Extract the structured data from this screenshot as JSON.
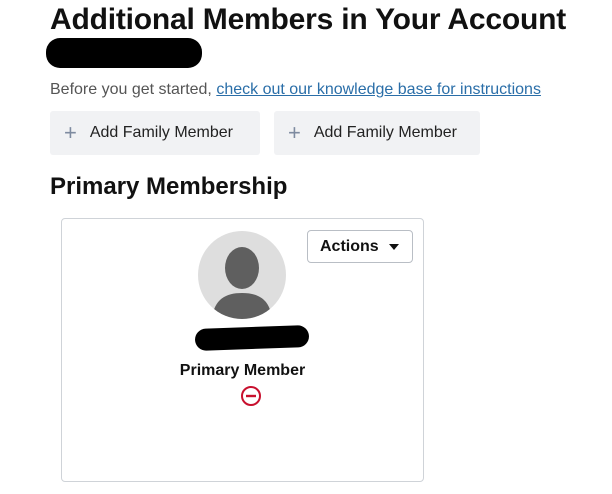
{
  "header": {
    "title": "Additional Members in Your Account"
  },
  "intro": {
    "text": "Before you get started, ",
    "link_text": "check out our knowledge base for instructions"
  },
  "add_buttons": [
    {
      "icon": "plus-icon",
      "label": "Add Family Member"
    },
    {
      "icon": "plus-icon",
      "label": "Add Family Member"
    }
  ],
  "primary_section": {
    "title": "Primary Membership",
    "card": {
      "actions_label": "Actions",
      "member_label": "Primary Member",
      "avatar_icon": "default-avatar-icon",
      "remove_icon": "remove-circle-icon",
      "remove_color": "#c8102e"
    }
  },
  "colors": {
    "link": "#2a6ea8",
    "button_bg": "#f1f2f4",
    "plus": "#7e8ba0",
    "card_border": "#cfd3d8"
  }
}
